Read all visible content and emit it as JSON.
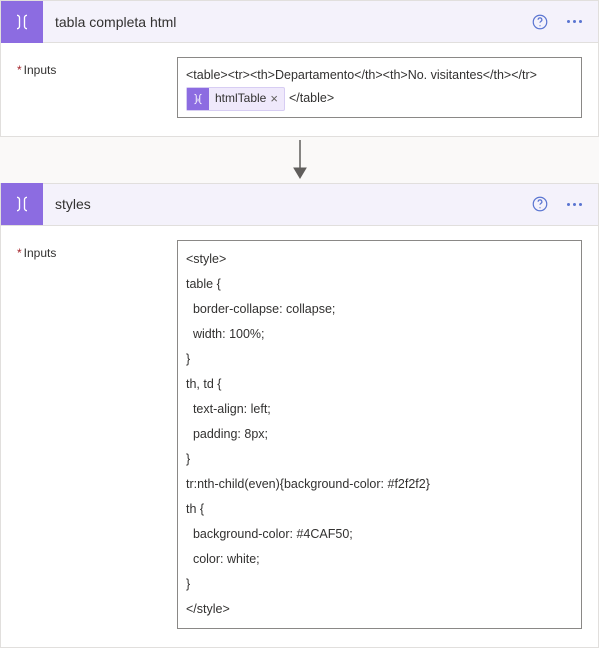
{
  "steps": [
    {
      "title": "tabla completa html",
      "inputs_label": "Inputs",
      "expression": {
        "line1": "<table><tr><th>Departamento</th><th>No. visitantes</th></tr>",
        "token": "htmlTable",
        "line2_suffix": "</table>"
      }
    },
    {
      "title": "styles",
      "inputs_label": "Inputs",
      "css_text": "<style>\ntable {\n  border-collapse: collapse;\n  width: 100%;\n}\nth, td {\n  text-align: left;\n  padding: 8px;\n}\ntr:nth-child(even){background-color: #f2f2f2}\nth {\n  background-color: #4CAF50;\n  color: white;\n}\n</style>"
    }
  ]
}
